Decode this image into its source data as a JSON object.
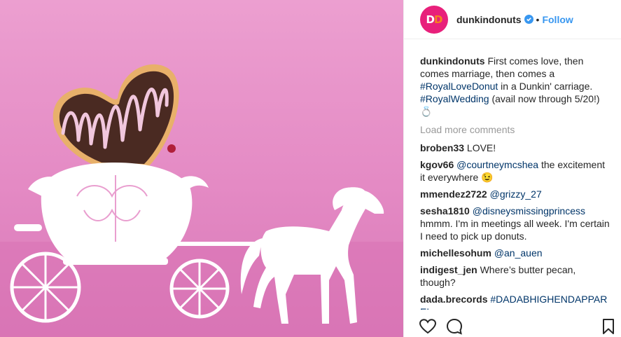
{
  "post": {
    "account": {
      "username": "dunkindonuts",
      "avatar_text_1": "D",
      "avatar_text_2": "D",
      "separator": "•",
      "follow_label": "Follow"
    },
    "caption": {
      "username": "dunkindonuts",
      "text_1": "First comes love, then comes marriage, then comes a ",
      "hashtag_1": "#RoyalLoveDonut",
      "text_2": " in a Dunkin' carriage. ",
      "hashtag_2": "#RoyalWedding",
      "text_3": " (avail now through 5/20!)",
      "emoji": "💍"
    },
    "load_more_label": "Load more comments",
    "comments": [
      {
        "username": "broben33",
        "text": "LOVE!"
      },
      {
        "username": "kgov66",
        "mention": "@courtneymcshea",
        "text": " the excitement it everywhere 😉"
      },
      {
        "username": "mmendez2722",
        "mention": "@grizzy_27",
        "text": ""
      },
      {
        "username": "sesha1810",
        "mention": "@disneysmissingprincess",
        "text": " hmmm. I'm in meetings all week. I'm certain I need to pick up donuts."
      },
      {
        "username": "michellesohum",
        "mention": "@an_auen",
        "text": ""
      },
      {
        "username": "indigest_jen",
        "text": "Where’s butter pecan, though?"
      },
      {
        "username": "dada.brecords",
        "mention": "#DADABHIGHENDAPPAR",
        "text": ""
      }
    ],
    "comment_overflow": "EL"
  },
  "colors": {
    "brand_pink": "#e8207b",
    "brand_orange": "#f5821f",
    "link_blue": "#3897f0",
    "hashtag_blue": "#003569",
    "muted_gray": "#999999",
    "photo_pink": "#e48ac4"
  },
  "icons": [
    "verified-badge-icon",
    "heart-icon",
    "comment-icon",
    "bookmark-icon",
    "ring-emoji-icon"
  ]
}
